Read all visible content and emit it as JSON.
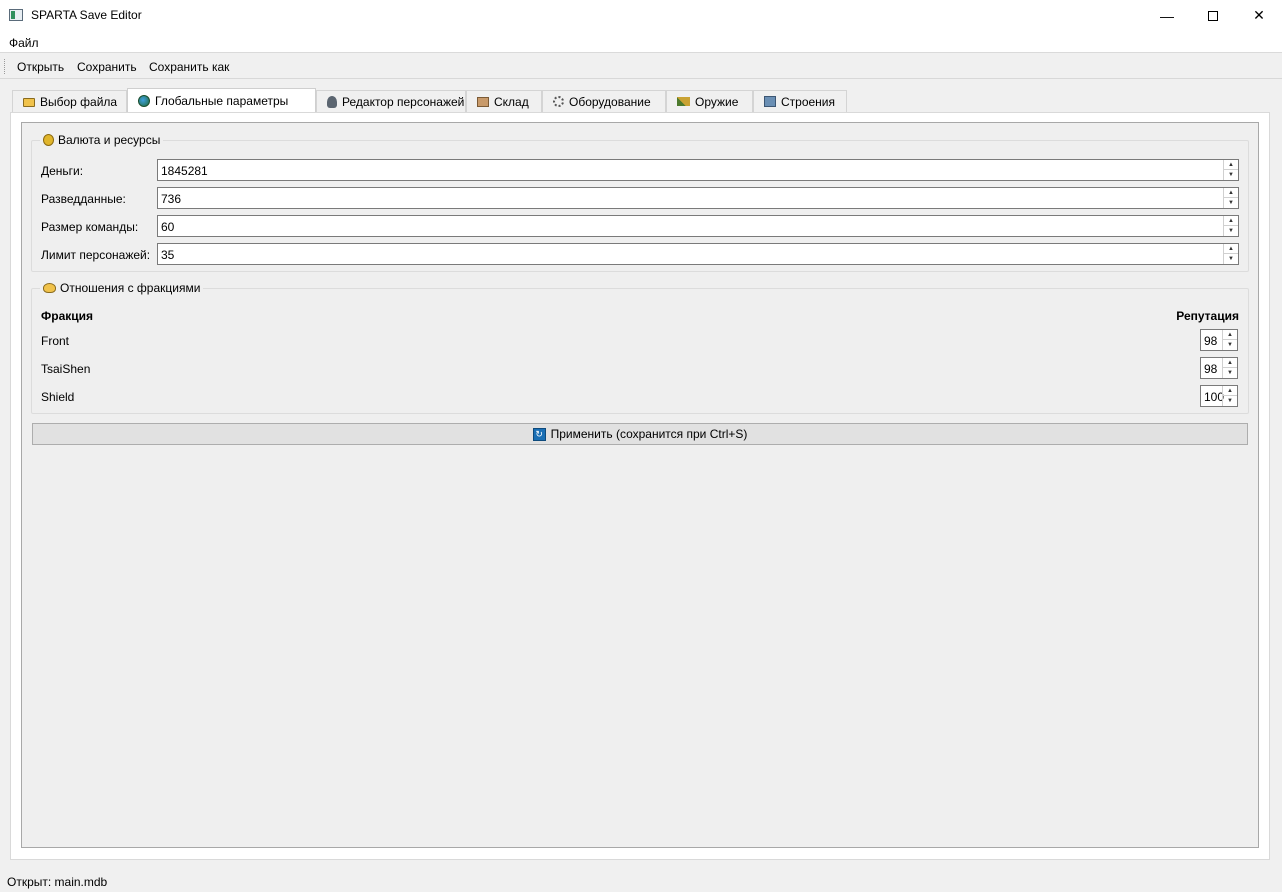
{
  "window": {
    "title": "SPARTA Save Editor"
  },
  "menu": {
    "file": "Файл"
  },
  "toolbar": {
    "open": "Открыть",
    "save": "Сохранить",
    "save_as": "Сохранить как"
  },
  "tabs": [
    {
      "label": "Выбор файла",
      "icon": "folder-icon",
      "active": false
    },
    {
      "label": "Глобальные параметры",
      "icon": "globe-icon",
      "active": true
    },
    {
      "label": "Редактор персонажей",
      "icon": "person-icon",
      "active": false
    },
    {
      "label": "Склад",
      "icon": "box-icon",
      "active": false
    },
    {
      "label": "Оборудование",
      "icon": "gear-icon",
      "active": false
    },
    {
      "label": "Оружие",
      "icon": "weapon-icon",
      "active": false
    },
    {
      "label": "Строения",
      "icon": "building-icon",
      "active": false
    }
  ],
  "resources": {
    "title": "Валюта и ресурсы",
    "fields": [
      {
        "label": "Деньги:",
        "value": "1845281"
      },
      {
        "label": "Разведданные:",
        "value": "736"
      },
      {
        "label": "Размер команды:",
        "value": "60"
      },
      {
        "label": "Лимит персонажей:",
        "value": "35"
      }
    ]
  },
  "factions": {
    "title": "Отношения с фракциями",
    "col_faction": "Фракция",
    "col_reputation": "Репутация",
    "rows": [
      {
        "name": "Front",
        "reputation": "98"
      },
      {
        "name": "TsaiShen",
        "reputation": "98"
      },
      {
        "name": "Shield",
        "reputation": "100"
      }
    ]
  },
  "apply_button": "Применить (сохранится при Ctrl+S)",
  "status": "Открыт: main.mdb"
}
